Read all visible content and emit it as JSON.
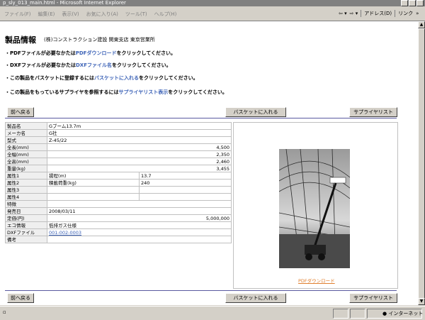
{
  "window": {
    "title": "p_sly_013_main.html - Microsoft Internet Explorer"
  },
  "menu": [
    "ファイル(F)",
    "編集(E)",
    "表示(V)",
    "お気に入り(A)",
    "ツール(T)",
    "ヘルプ(H)"
  ],
  "toolbar": {
    "address_label": "アドレス(D)",
    "links_label": "リンク"
  },
  "page": {
    "title": "製品情報",
    "company": "(株)コンストラクション建設 関東支店 東京営業所",
    "lines": [
      {
        "pre": "・PDFファイルが必要なかたは",
        "link": "PDFダウンロード",
        "post": "をクリックしてください。"
      },
      {
        "pre": "・DXFファイルが必要なかたは",
        "link": "DXFファイル名",
        "post": "をクリックしてください。"
      },
      {
        "pre": "・この製品をバスケットに登録するには",
        "link": "バスケットに入れる",
        "post": "をクリックしてください。"
      },
      {
        "pre": "・この製品をもっているサプライヤを参照するには",
        "link": "サプライヤリスト表示",
        "post": "をクリックしてください。"
      }
    ],
    "buttons": {
      "back": "前へ戻る",
      "basket": "バスケットに入れる",
      "supplier": "サプライヤリスト"
    }
  },
  "spec": {
    "name_label": "製品名",
    "name": "Gブーム13.7m",
    "maker_label": "メーカ名",
    "maker": "G社",
    "model_label": "型式",
    "model": "Z-45/22",
    "length_label": "全長(mm)",
    "length": "4,500",
    "width_label": "全幅(mm)",
    "width": "2,350",
    "height_label": "全高(mm)",
    "height": "2,460",
    "weight_label": "重量(kg)",
    "weight": "3,455",
    "attr1_label": "属性1",
    "attr1_name": "揚程(m)",
    "attr1_value": "13.7",
    "attr2_label": "属性2",
    "attr2_name": "積載荷重(kg)",
    "attr2_value": "240",
    "attr3_label": "属性3",
    "attr4_label": "属性4",
    "feature_label": "特徴",
    "release_label": "発売日",
    "release": "2008/03/11",
    "price_label": "定価(円)",
    "price": "5,000,000",
    "eco_label": "エコ情報",
    "eco": "低排ガス仕様",
    "dxf_label": "DXFファイル",
    "dxf": "001-002-0003",
    "note_label": "備考"
  },
  "pdf_link": "PDFダウンロード",
  "status": {
    "zone": "インターネット"
  }
}
